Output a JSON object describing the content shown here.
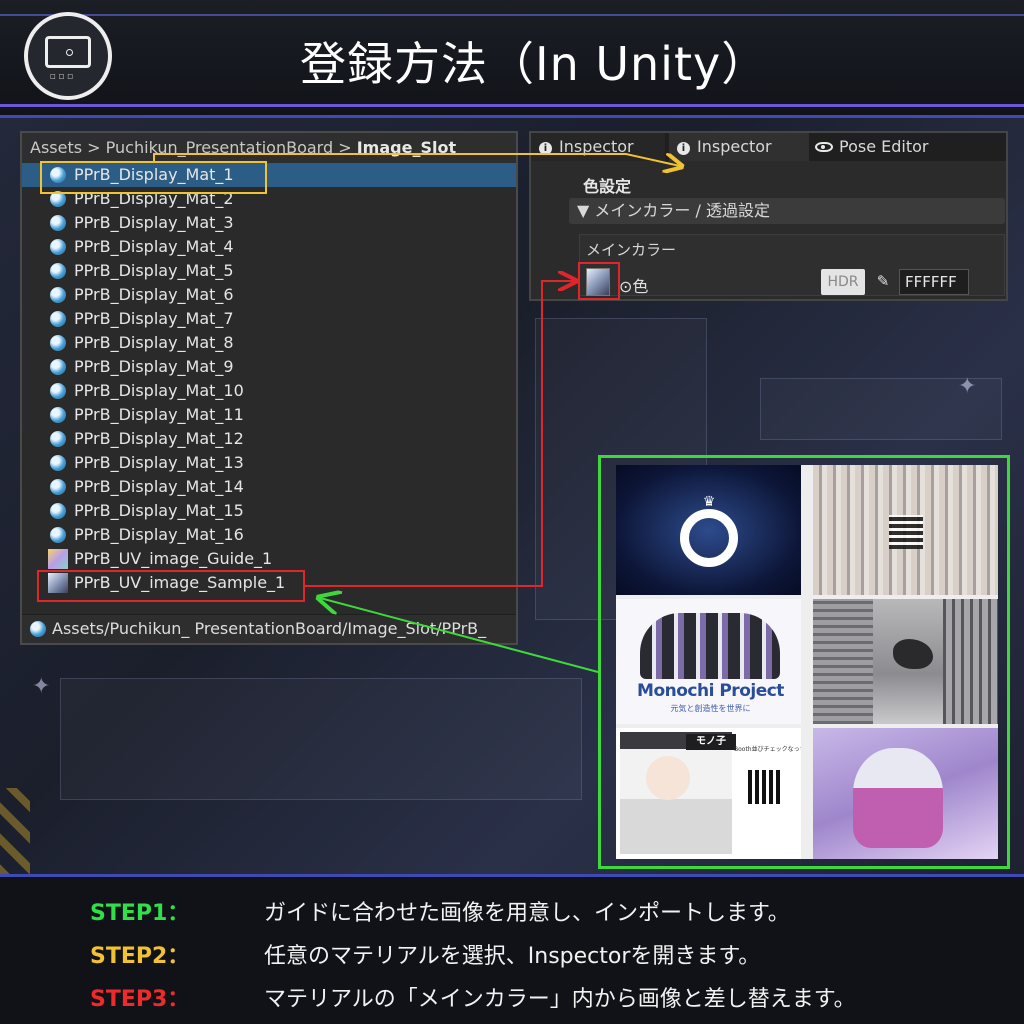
{
  "header": {
    "title": "登録方法（In Unity）"
  },
  "project_panel": {
    "breadcrumb": {
      "root": "Assets",
      "sep": ">",
      "folder": "Puchikun_PresentationBoard",
      "current": "Image_Slot"
    },
    "items": [
      {
        "label": "PPrB_Display_Mat_1",
        "type": "material",
        "selected": true
      },
      {
        "label": "PPrB_Display_Mat_2",
        "type": "material"
      },
      {
        "label": "PPrB_Display_Mat_3",
        "type": "material"
      },
      {
        "label": "PPrB_Display_Mat_4",
        "type": "material"
      },
      {
        "label": "PPrB_Display_Mat_5",
        "type": "material"
      },
      {
        "label": "PPrB_Display_Mat_6",
        "type": "material"
      },
      {
        "label": "PPrB_Display_Mat_7",
        "type": "material"
      },
      {
        "label": "PPrB_Display_Mat_8",
        "type": "material"
      },
      {
        "label": "PPrB_Display_Mat_9",
        "type": "material"
      },
      {
        "label": "PPrB_Display_Mat_10",
        "type": "material"
      },
      {
        "label": "PPrB_Display_Mat_11",
        "type": "material"
      },
      {
        "label": "PPrB_Display_Mat_12",
        "type": "material"
      },
      {
        "label": "PPrB_Display_Mat_13",
        "type": "material"
      },
      {
        "label": "PPrB_Display_Mat_14",
        "type": "material"
      },
      {
        "label": "PPrB_Display_Mat_15",
        "type": "material"
      },
      {
        "label": "PPrB_Display_Mat_16",
        "type": "material"
      },
      {
        "label": "PPrB_UV_image_Guide_1",
        "type": "texture"
      },
      {
        "label": "PPrB_UV_image_Sample_1",
        "type": "texture"
      }
    ],
    "footer_path": "Assets/Puchikun_ PresentationBoard/Image_Slot/PPrB_"
  },
  "inspector": {
    "tabs": [
      {
        "label": "Inspector",
        "icon": "info-icon"
      },
      {
        "label": "Inspector",
        "icon": "info-icon"
      },
      {
        "label": "Pose Editor",
        "icon": "eye-icon"
      }
    ],
    "section_title": "色設定",
    "foldout_label": "▼ メインカラー / 透過設定",
    "subsection_title": "メインカラー",
    "color_label": "⊙色",
    "hdr_label": "HDR",
    "hex_value": "FFFFFF"
  },
  "gallery": {
    "tile_c_logo": "Monochi Project",
    "tile_c_sub": "元気と創造性を世界に",
    "tile_e_title": "モノ子",
    "tile_e_note": "Booth並びチェックなっちゃ！"
  },
  "steps": [
    {
      "label": "STEP1：",
      "color": "#2fe04a",
      "text": "ガイドに合わせた画像を用意し、インポートします。"
    },
    {
      "label": "STEP2：",
      "color": "#f3c232",
      "text": "任意のマテリアルを選択、Inspectorを開きます。"
    },
    {
      "label": "STEP3：",
      "color": "#ee2a2a",
      "text": "マテリアルの「メインカラー」内から画像と差し替えます。"
    }
  ],
  "colors": {
    "yellow_highlight": "#f1c232",
    "red_highlight": "#e0262b",
    "green_highlight": "#3ed83c",
    "accent_line": "#3d4ab8"
  }
}
